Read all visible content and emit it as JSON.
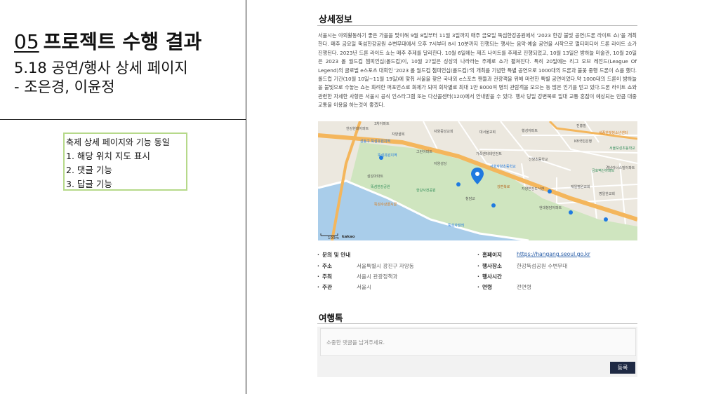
{
  "slide": {
    "number": "05",
    "title": "프로젝트 수행 결과",
    "subtitle_line1": "5.18 공연/행사 상세 페이지",
    "subtitle_line2": "- 조은경, 이윤정"
  },
  "note": {
    "heading": "축제 상세 페이지와 기능 동일",
    "items": [
      "1. 해당 위치 지도 표시",
      "2. 댓글 기능",
      "3. 답글 기능"
    ]
  },
  "detail": {
    "section_title": "상세정보",
    "description": "서울시는 야외활동하기 좋은 가을을 맞이해 9월 8일부터 11월 3일까지 매주 금요일 뚝섬한강공원에서 '2023 한강 불빛 공연(드론 라이트 쇼)'을 개최한다. 매주 금요일 뚝섬한강공원 수변무대에서 오후 7시부터 8시 10분까지 진행되는 행사는 음악·예술 공연을 시작으로 멀티미디어 드론 라이트 쇼가 진행된다. 2023년 드론 라이트 쇼는 매주 주제를 달리한다. 10월 6일에는 재즈 나이트를 주제로 진행되었고, 10월 13일은 방하늘 미술관, 10월 20일은 2023 롤 월드컵 챔피언십(롤드컵)이, 10월 27일은 상상의 나라라는 주제로 쇼가 펼쳐진다. 특히 20일에는 리그 오브 레전드(League Of Legend)의 글로벌 e스포츠 대회인 '2023 롤 월드컵 챔피언십(롤드컵)'의 개최를 기념한 특별 공연으로 1000대의 드론과 불꽃 중행 드론이 쇼를 했다. 롤드컵 기간(10월 10일~11월 19일)에 맞춰 서울을 찾은 국내외 e스포츠 팬들과 관광객을 위해 마련한 특별 공연이었다.약 1000대의 드론이 밤하늘을 불빛으로 수놓는 쇼는 화려한 퍼포먼스로 화제가 되며 회차별로 최대 1만 8000여 명의 관람객을 모으는 등 많은 인기를 얻고 있다.드론 라이트 쇼와 관련한 자세한 사항은 서울시 공식 인스타그램 또는 다산콜센터(120)에서 안내받을 수 있다. 행사 당일 강변북로 일대 교통 혼잡이 예상되는 만큼 대중교통을 이용을 하는것이 좋겠다."
  },
  "map": {
    "labels": {
      "area1": "3차아파트",
      "area2": "한강현대아파트",
      "area3": "자양중앙교회",
      "area4": "자양골목",
      "area5": "대서울교회",
      "area6": "행성아파트",
      "area7": "진흥빌",
      "area8": "세종한빛청소년센터",
      "area9": "KB국민은행",
      "area10": "서울보성초등학교",
      "area11": "성동구 뚝섬유원지역",
      "area12": "뚝섬유원지역",
      "area13": "그린아파트",
      "area14": "가족엔터테인먼트",
      "area15": "자양성당",
      "area16": "서울자양초등학교",
      "area17": "신양초등학교",
      "area18": "자양한강도서관",
      "area19": "삼성아파트",
      "area20": "뚝섬한강공원",
      "area21": "한강사전공원",
      "area22": "청담교",
      "area23": "강변북로",
      "area24": "뚝섬자벌레",
      "area25": "제일병원교회",
      "area26": "경남아너스빌아파트",
      "area27": "뚝섬수상골시골",
      "area28": "현대청담아파트",
      "area29": "금호벽산아파트",
      "area30": "명일한교회",
      "scale": "100m",
      "brand": "kakao"
    },
    "marker_color": "#1f7ae0"
  },
  "info": {
    "left": [
      {
        "key": "문의 및 안내",
        "value": ""
      },
      {
        "key": "주소",
        "value": "서울특별시 광진구 자양동"
      },
      {
        "key": "주최",
        "value": "서울시 관광정책과"
      },
      {
        "key": "주관",
        "value": "서울시"
      }
    ],
    "right": [
      {
        "key": "홈페이지",
        "value": "https://hangang.seoul.go.kr"
      },
      {
        "key": "행사장소",
        "value": "한강뚝섬공원 수변무대"
      },
      {
        "key": "행사시간",
        "value": ""
      },
      {
        "key": "연령",
        "value": "전연령"
      }
    ]
  },
  "review": {
    "title": "여행톡",
    "placeholder": "소중한 댓글을 남겨주세요.",
    "submit_label": "등록"
  },
  "colors": {
    "accent": "#1f2a44",
    "note_border": "#b6d98a",
    "link": "#2b5fa8"
  }
}
